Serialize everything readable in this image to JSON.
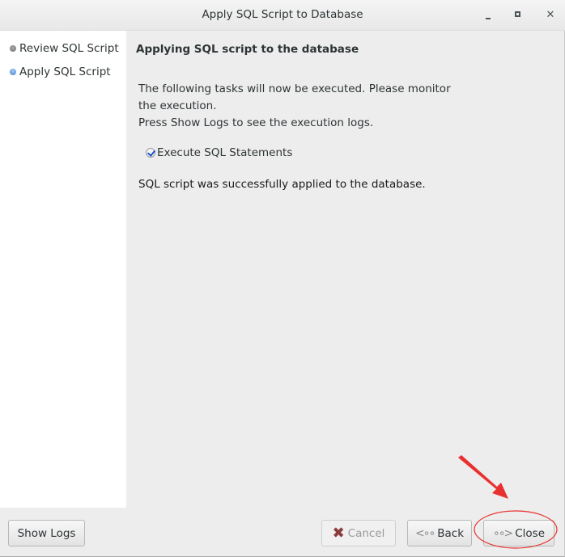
{
  "window": {
    "title": "Apply SQL Script to Database",
    "controls": {
      "minimize": "_",
      "maximize": "□",
      "close": "✕"
    }
  },
  "sidebar": {
    "steps": [
      {
        "label": "Review SQL Script",
        "state": "done",
        "icon": "bullet-gray-icon"
      },
      {
        "label": "Apply SQL Script",
        "state": "active",
        "icon": "bullet-blue-icon"
      }
    ]
  },
  "content": {
    "heading": "Applying SQL script to the database",
    "instructions": [
      "The following tasks will now be executed. Please monitor",
      "the execution.",
      "Press Show Logs to see the execution logs."
    ],
    "tasks": [
      {
        "label": "Execute SQL Statements",
        "checked": true
      }
    ],
    "result_message": "SQL script was successfully applied to the database."
  },
  "footer": {
    "show_logs_label": "Show Logs",
    "cancel_label": "Cancel",
    "back_label": "Back",
    "close_label": "Close",
    "cancel_enabled": false
  },
  "annotation": {
    "color": "#e8312f",
    "target": "close-button"
  }
}
